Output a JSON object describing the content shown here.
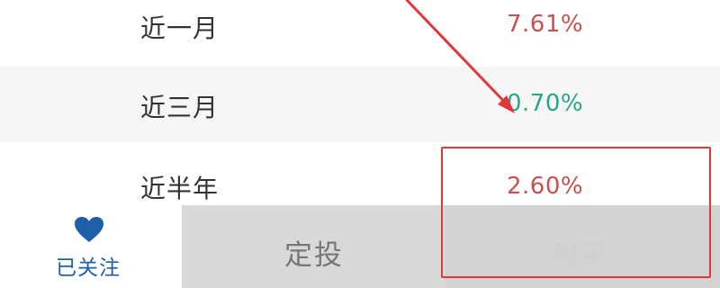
{
  "returns": [
    {
      "period": "近一月",
      "value": "7.61%",
      "color": "#c9504e"
    },
    {
      "period": "近三月",
      "value": "0.70%",
      "color": "#2aa58a"
    },
    {
      "period": "近半年",
      "value": "2.60%",
      "color": "#c9504e"
    }
  ],
  "bottom_bar": {
    "follow_label": "已关注",
    "follow_color": "#1f5fa8",
    "invest_label": "定投",
    "buy_label": "购买"
  },
  "annotation": {
    "color": "#e0383a"
  }
}
